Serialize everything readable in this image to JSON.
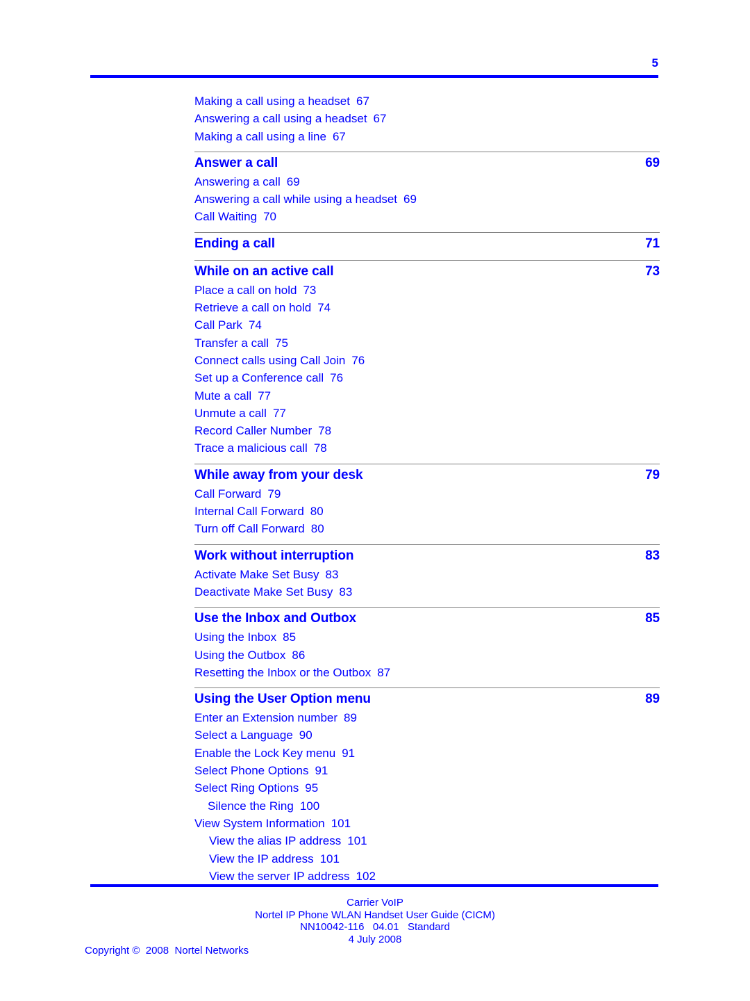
{
  "page": {
    "number": "5",
    "rule_color": "#0000ff",
    "separator_color": "#808080",
    "text_color": "#0000ff"
  },
  "toc": {
    "lead_entries": [
      {
        "label": "Making a call using a headset",
        "page": "67",
        "level": 1
      },
      {
        "label": "Answering a call using a headset",
        "page": "67",
        "level": 1
      },
      {
        "label": "Making a call using a line",
        "page": "67",
        "level": 1
      }
    ],
    "sections": [
      {
        "title": "Answer a call",
        "page": "69",
        "entries": [
          {
            "label": "Answering a call",
            "page": "69",
            "level": 1
          },
          {
            "label": "Answering a call while using a headset",
            "page": "69",
            "level": 1
          },
          {
            "label": "Call Waiting",
            "page": "70",
            "level": 1
          }
        ]
      },
      {
        "title": "Ending a call",
        "page": "71",
        "entries": []
      },
      {
        "title": "While on an active call",
        "page": "73",
        "entries": [
          {
            "label": "Place a call on hold",
            "page": "73",
            "level": 1
          },
          {
            "label": "Retrieve a call on hold",
            "page": "74",
            "level": 1
          },
          {
            "label": "Call Park",
            "page": "74",
            "level": 1
          },
          {
            "label": "Transfer a call",
            "page": "75",
            "level": 1
          },
          {
            "label": "Connect calls using Call Join",
            "page": "76",
            "level": 1
          },
          {
            "label": "Set up a Conference call",
            "page": "76",
            "level": 1
          },
          {
            "label": "Mute a call",
            "page": "77",
            "level": 1
          },
          {
            "label": "Unmute a call",
            "page": "77",
            "level": 1
          },
          {
            "label": "Record Caller Number",
            "page": "78",
            "level": 1
          },
          {
            "label": "Trace a malicious call",
            "page": "78",
            "level": 1
          }
        ]
      },
      {
        "title": "While away from your desk",
        "page": "79",
        "entries": [
          {
            "label": "Call Forward",
            "page": "79",
            "level": 1
          },
          {
            "label": "Internal Call Forward",
            "page": "80",
            "level": 1
          },
          {
            "label": "Turn off Call Forward",
            "page": "80",
            "level": 1
          }
        ]
      },
      {
        "title": "Work without interruption",
        "page": "83",
        "entries": [
          {
            "label": "Activate Make Set Busy",
            "page": "83",
            "level": 1
          },
          {
            "label": "Deactivate Make Set Busy",
            "page": "83",
            "level": 1
          }
        ]
      },
      {
        "title": "Use the Inbox and Outbox",
        "page": "85",
        "entries": [
          {
            "label": "Using the Inbox",
            "page": "85",
            "level": 1
          },
          {
            "label": "Using the Outbox",
            "page": "86",
            "level": 1
          },
          {
            "label": "Resetting the Inbox or the Outbox",
            "page": "87",
            "level": 1
          }
        ]
      },
      {
        "title": "Using the User Option menu",
        "page": "89",
        "entries": [
          {
            "label": "Enter an Extension number",
            "page": "89",
            "level": 1
          },
          {
            "label": "Select a Language",
            "page": "90",
            "level": 1
          },
          {
            "label": "Enable the Lock Key menu",
            "page": "91",
            "level": 1
          },
          {
            "label": "Select Phone Options",
            "page": "91",
            "level": 1
          },
          {
            "label": "Select Ring Options",
            "page": "95",
            "level": 1
          },
          {
            "label": "Silence the Ring",
            "page": "100",
            "level": 2
          },
          {
            "label": "View System Information",
            "page": "101",
            "level": 1
          },
          {
            "label": "View the alias IP address",
            "page": "101",
            "level": 3
          },
          {
            "label": "View the IP address",
            "page": "101",
            "level": 3
          },
          {
            "label": "View the server IP address",
            "page": "102",
            "level": 3
          }
        ]
      }
    ]
  },
  "footer": {
    "lines": [
      "Carrier VoIP",
      "Nortel IP Phone WLAN Handset User Guide (CICM)",
      "NN10042-116   04.01   Standard",
      "4 July 2008"
    ],
    "copyright": "Copyright ©  2008  Nortel Networks"
  }
}
